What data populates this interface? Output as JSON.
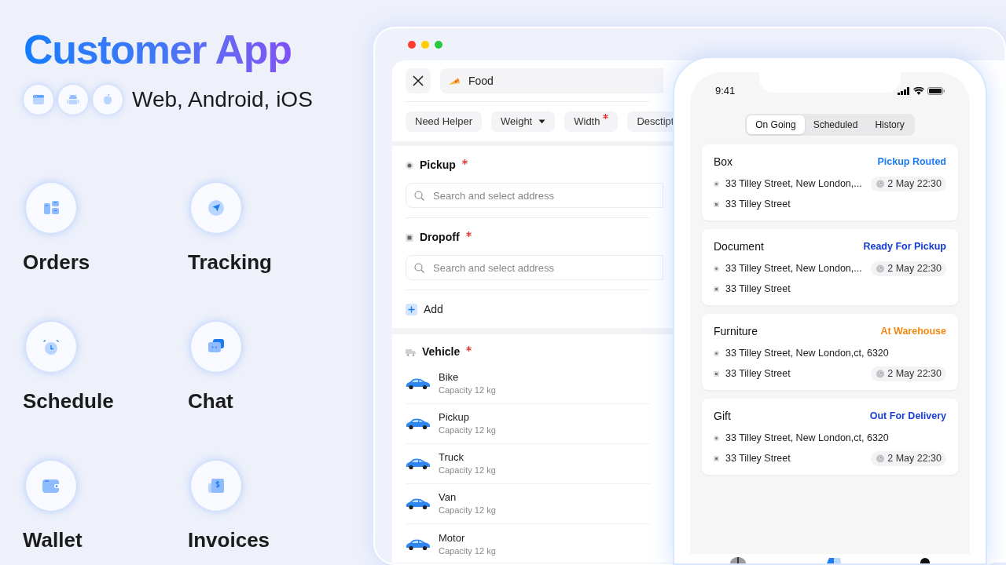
{
  "hero": {
    "title": "Customer App",
    "platforms_label": "Web, Android, iOS",
    "platforms": [
      {
        "kind": "web"
      },
      {
        "kind": "android"
      },
      {
        "kind": "ios"
      }
    ]
  },
  "features": [
    {
      "label": "Orders",
      "kind": "orders"
    },
    {
      "label": "Tracking",
      "kind": "tracking"
    },
    {
      "label": "Schedule",
      "kind": "schedule"
    },
    {
      "label": "Chat",
      "kind": "chat"
    },
    {
      "label": "Wallet",
      "kind": "wallet"
    },
    {
      "label": "Invoices",
      "kind": "invoices"
    }
  ],
  "web_window": {
    "category": "Food",
    "filters": [
      {
        "label": "Need Helper",
        "dropdown": false,
        "required": false
      },
      {
        "label": "Weight",
        "dropdown": true,
        "required": false
      },
      {
        "label": "Width",
        "dropdown": false,
        "required": true
      },
      {
        "label": "Desctipt",
        "dropdown": false,
        "required": false
      }
    ],
    "stops": [
      {
        "kind": "pickup",
        "label": "Pickup",
        "required": true,
        "placeholder": "Search and select address"
      },
      {
        "kind": "dropoff",
        "label": "Dropoff",
        "required": true,
        "placeholder": "Search and select address"
      }
    ],
    "add_label": "Add",
    "vehicle": {
      "label": "Vehicle",
      "required": true,
      "options": [
        {
          "name": "Bike",
          "capacity": "Capacity 12 kg"
        },
        {
          "name": "Pickup",
          "capacity": "Capacity 12 kg"
        },
        {
          "name": "Truck",
          "capacity": "Capacity 12 kg"
        },
        {
          "name": "Van",
          "capacity": "Capacity 12 kg"
        },
        {
          "name": "Motor",
          "capacity": "Capacity 12 kg"
        }
      ]
    }
  },
  "phone": {
    "time": "9:41",
    "tabs": [
      {
        "label": "On Going",
        "selected": true
      },
      {
        "label": "Scheduled",
        "selected": false
      },
      {
        "label": "History",
        "selected": false
      }
    ],
    "orders": [
      {
        "name": "Box",
        "status": "Pickup Routed",
        "color": "#1f7bf2",
        "pickup": "33 Tilley Street, New London,...",
        "dropoff": "33 Tilley Street",
        "time": "2 May 22:30",
        "time_on_dropoff": false
      },
      {
        "name": "Document",
        "status": "Ready For Pickup",
        "color": "#1239d6",
        "pickup": "33 Tilley Street, New London,...",
        "dropoff": "33 Tilley Street",
        "time": "2 May 22:30",
        "time_on_dropoff": false
      },
      {
        "name": "Furniture",
        "status": "At Warehouse",
        "color": "#f08a12",
        "pickup": "33 Tilley Street, New London,ct, 6320",
        "dropoff": "33 Tilley Street",
        "time": "2 May 22:30",
        "time_on_dropoff": true
      },
      {
        "name": "Gift",
        "status": "Out For Delivery",
        "color": "#1a3fd8",
        "pickup": "33 Tilley Street, New London,ct, 6320",
        "dropoff": "33 Tilley Street",
        "time": "2 May 22:30",
        "time_on_dropoff": true
      }
    ]
  }
}
